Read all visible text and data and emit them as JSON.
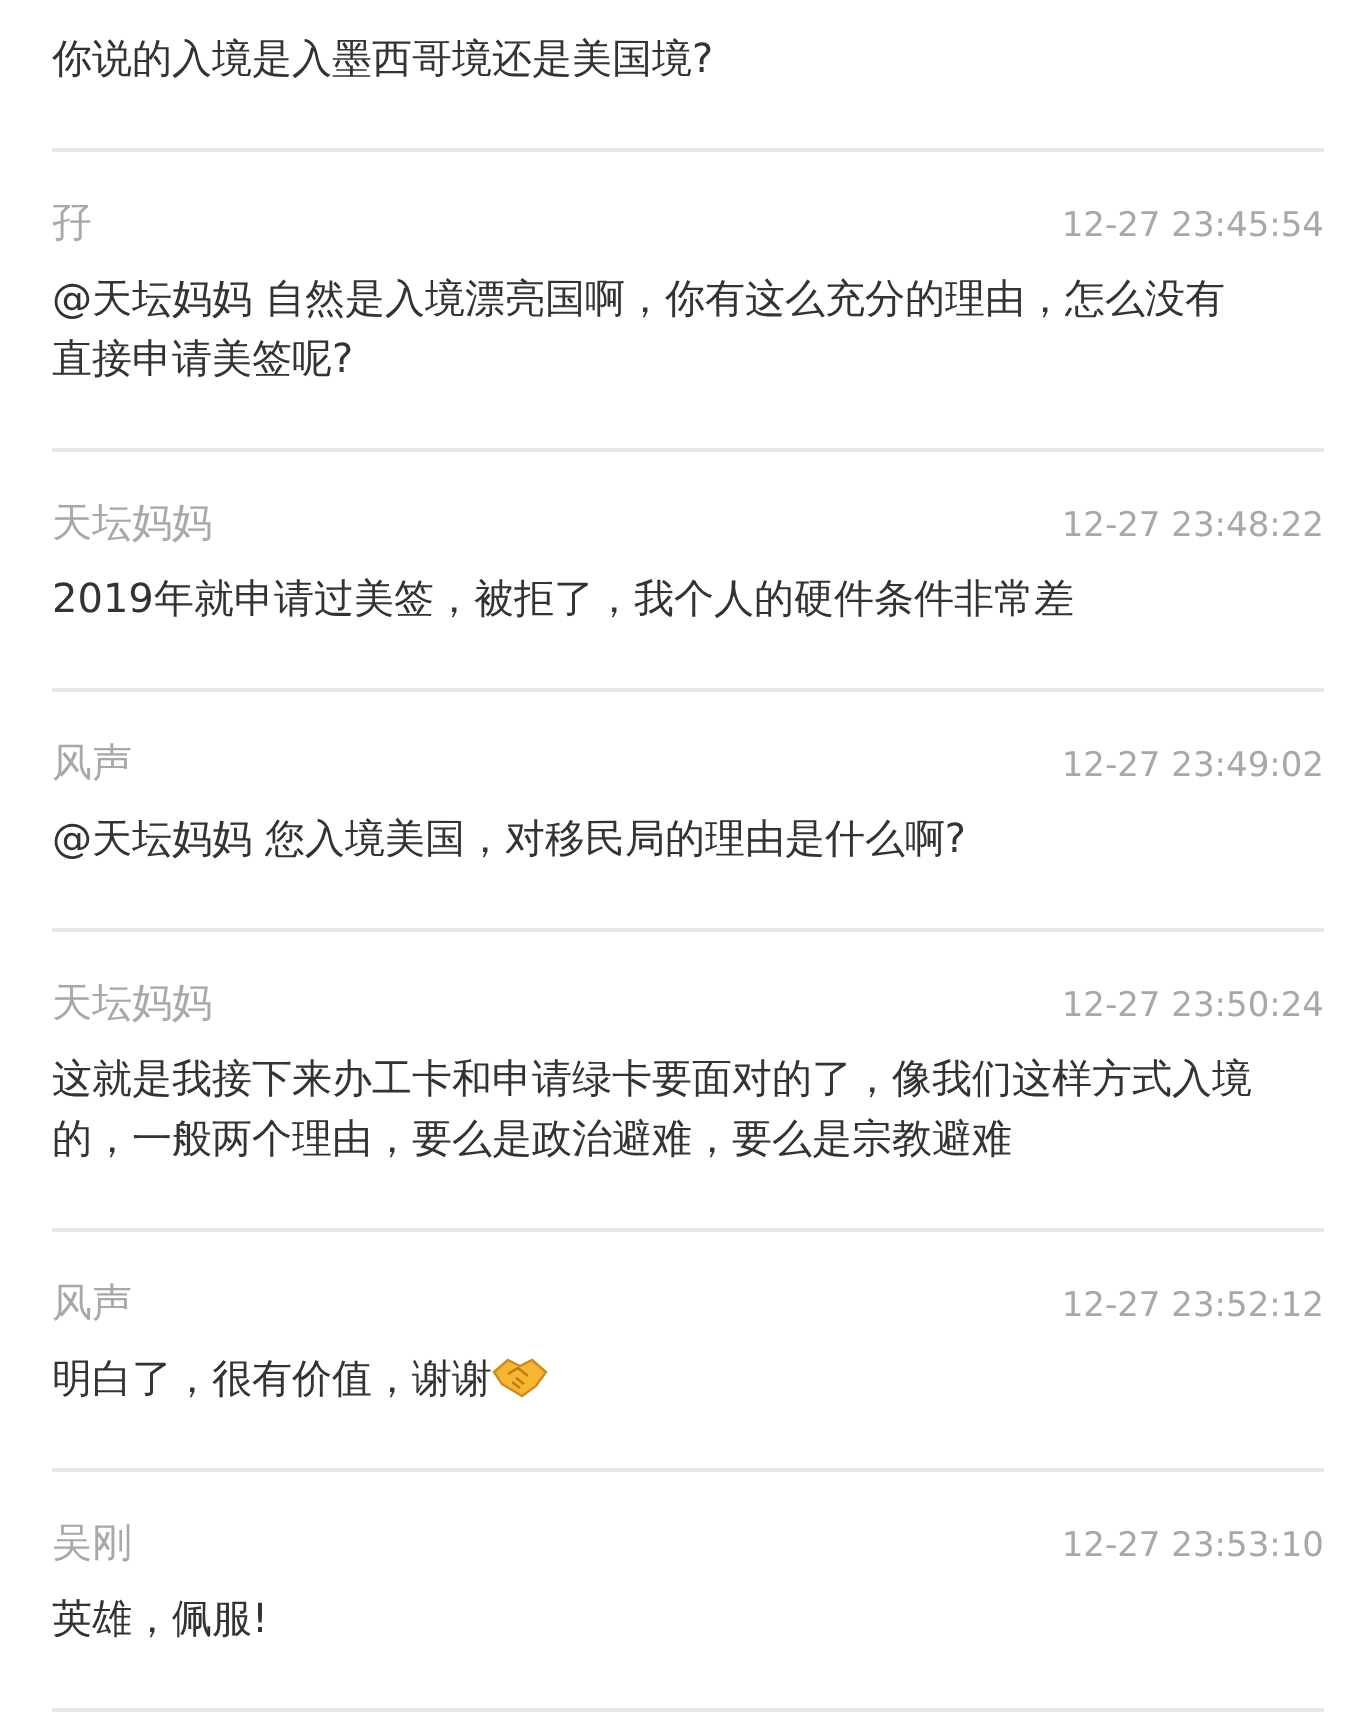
{
  "comments": [
    {
      "kind": "text",
      "text": "你说的入境是入墨西哥境还是美国境?"
    },
    {
      "name": "孖",
      "time": "12-27 23:45:54",
      "text": "@天坛妈妈 自然是入境漂亮国啊，你有这么充分的理由，怎么没有直接申请美签呢?"
    },
    {
      "name": "天坛妈妈",
      "time": "12-27 23:48:22",
      "text": "2019年就申请过美签，被拒了，我个人的硬件条件非常差"
    },
    {
      "name": "风声",
      "time": "12-27 23:49:02",
      "text": "@天坛妈妈 您入境美国，对移民局的理由是什么啊?"
    },
    {
      "name": "天坛妈妈",
      "time": "12-27 23:50:24",
      "text": "这就是我接下来办工卡和申请绿卡要面对的了，像我们这样方式入境的，一般两个理由，要么是政治避难，要么是宗教避难"
    },
    {
      "name": "风声",
      "time": "12-27 23:52:12",
      "text": "明白了，很有价值，谢谢",
      "kind": "emoji"
    },
    {
      "name": "吴刚",
      "time": "12-27 23:53:10",
      "text": "英雄，佩服!"
    }
  ]
}
